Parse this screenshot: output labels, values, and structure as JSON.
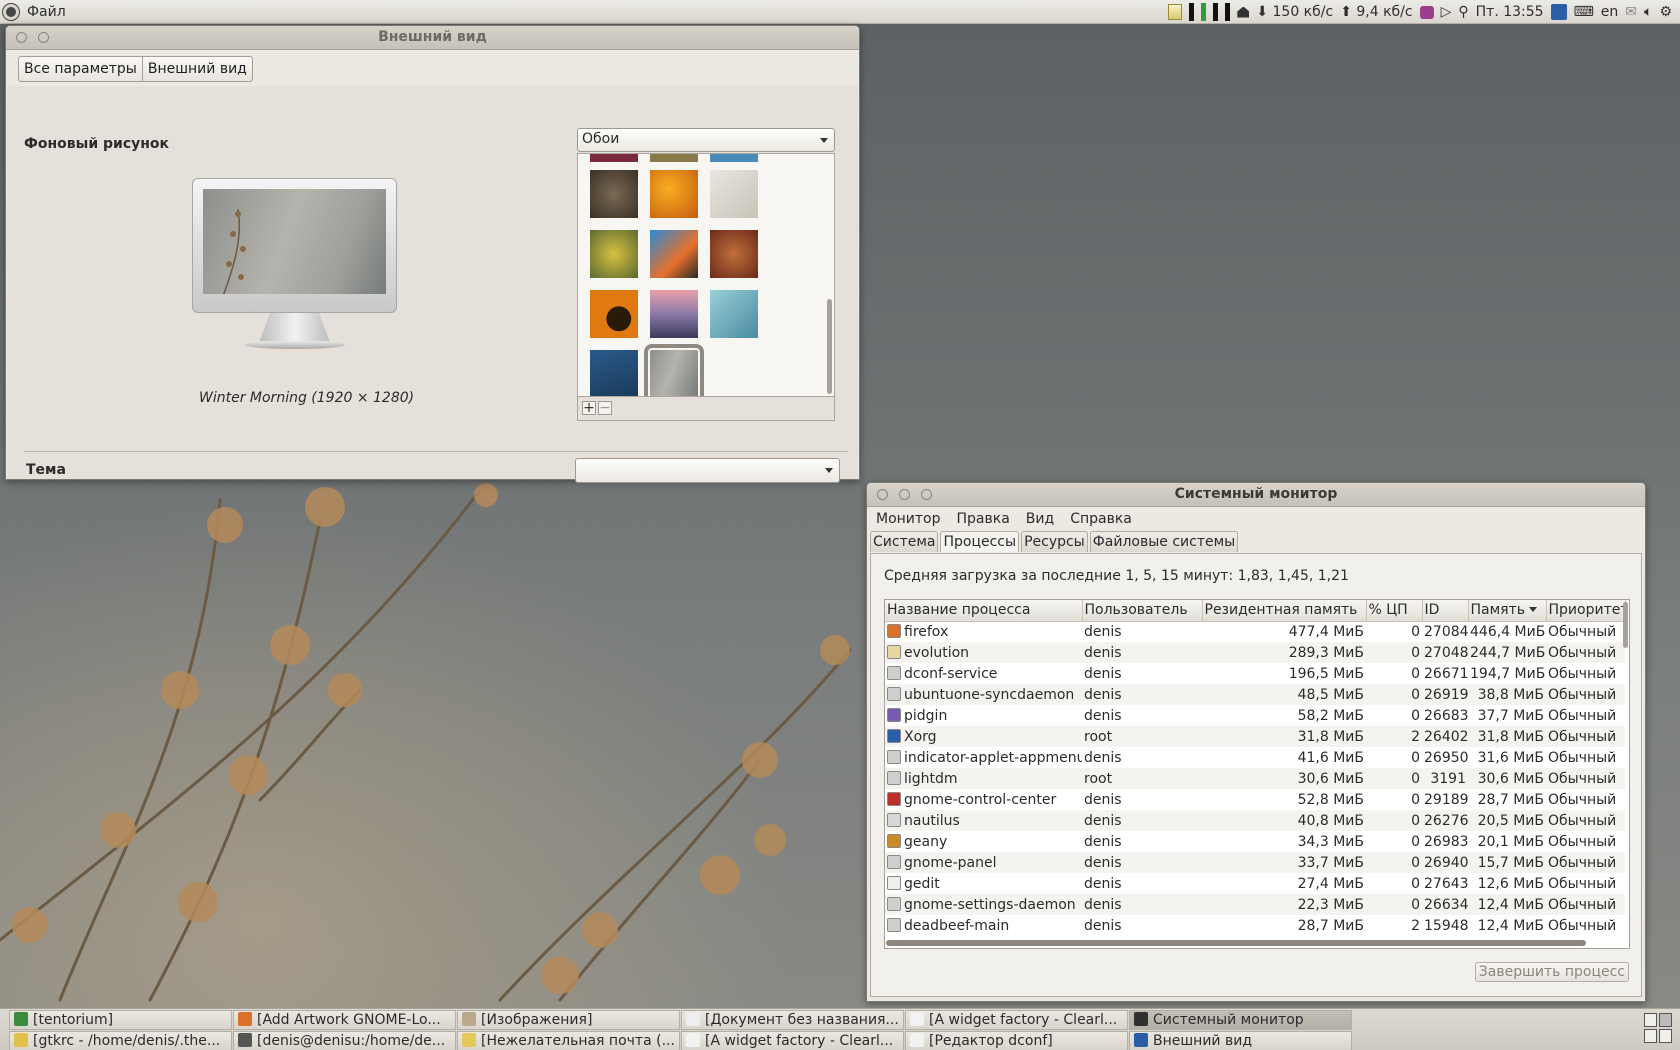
{
  "top_panel": {
    "app_menu": "Файл",
    "net_down": "150 кб/с",
    "net_up": "9,4 кб/с",
    "clock": "Пт. 13:55",
    "keyboard_layout": "en"
  },
  "appearance": {
    "title": "Внешний вид",
    "crumbs": [
      "Все параметры",
      "Внешний вид"
    ],
    "background_label": "Фоновый рисунок",
    "wallpaper_name": "Winter Morning (1920 × 1280)",
    "wallpaper_source": "Обои",
    "add_label": "+",
    "remove_label": "−",
    "theme_label": "Тема",
    "theme_value": ""
  },
  "sysmon": {
    "title": "Системный монитор",
    "menu": [
      "Монитор",
      "Правка",
      "Вид",
      "Справка"
    ],
    "tabs": [
      "Система",
      "Процессы",
      "Ресурсы",
      "Файловые системы"
    ],
    "active_tab": "Процессы",
    "load_avg": "Средняя загрузка за последние 1, 5, 15 минут: 1,83, 1,45, 1,21",
    "columns": [
      "Название процесса",
      "Пользователь",
      "Резидентная память",
      "% ЦП",
      "ID",
      "Память",
      "Приоритет"
    ],
    "processes": [
      {
        "name": "firefox",
        "user": "denis",
        "rss": "477,4 МиБ",
        "cpu": "0",
        "id": "27084",
        "mem": "446,4 МиБ",
        "prio": "Обычный",
        "icon": "firefox-icon",
        "color": "#d9712b"
      },
      {
        "name": "evolution",
        "user": "denis",
        "rss": "289,3 МиБ",
        "cpu": "0",
        "id": "27048",
        "mem": "244,7 МиБ",
        "prio": "Обычный",
        "icon": "evolution-icon",
        "color": "#e6d6a3"
      },
      {
        "name": "dconf-service",
        "user": "denis",
        "rss": "196,5 МиБ",
        "cpu": "0",
        "id": "26671",
        "mem": "194,7 МиБ",
        "prio": "Обычный",
        "icon": "gear-icon",
        "color": "#cfcfcf"
      },
      {
        "name": "ubuntuone-syncdaemon",
        "user": "denis",
        "rss": "48,5 МиБ",
        "cpu": "0",
        "id": "26919",
        "mem": "38,8 МиБ",
        "prio": "Обычный",
        "icon": "gear-icon",
        "color": "#cfcfcf"
      },
      {
        "name": "pidgin",
        "user": "denis",
        "rss": "58,2 МиБ",
        "cpu": "0",
        "id": "26683",
        "mem": "37,7 МиБ",
        "prio": "Обычный",
        "icon": "pidgin-icon",
        "color": "#7a5ab0"
      },
      {
        "name": "Xorg",
        "user": "root",
        "rss": "31,8 МиБ",
        "cpu": "2",
        "id": "26402",
        "mem": "31,8 МиБ",
        "prio": "Обычный",
        "icon": "monitor-icon",
        "color": "#2a5fa8"
      },
      {
        "name": "indicator-applet-appmenu",
        "user": "denis",
        "rss": "41,6 МиБ",
        "cpu": "0",
        "id": "26950",
        "mem": "31,6 МиБ",
        "prio": "Обычный",
        "icon": "gear-icon",
        "color": "#cfcfcf"
      },
      {
        "name": "lightdm",
        "user": "root",
        "rss": "30,6 МиБ",
        "cpu": "0",
        "id": "3191",
        "mem": "30,6 МиБ",
        "prio": "Обычный",
        "icon": "gear-icon",
        "color": "#cfcfcf"
      },
      {
        "name": "gnome-control-center",
        "user": "denis",
        "rss": "52,8 МиБ",
        "cpu": "0",
        "id": "29189",
        "mem": "28,7 МиБ",
        "prio": "Обычный",
        "icon": "control-center-icon",
        "color": "#c0302a"
      },
      {
        "name": "nautilus",
        "user": "denis",
        "rss": "40,8 МиБ",
        "cpu": "0",
        "id": "26276",
        "mem": "20,5 МиБ",
        "prio": "Обычный",
        "icon": "file-manager-icon",
        "color": "#d8d8d8"
      },
      {
        "name": "geany",
        "user": "denis",
        "rss": "34,3 МиБ",
        "cpu": "0",
        "id": "26983",
        "mem": "20,1 МиБ",
        "prio": "Обычный",
        "icon": "geany-icon",
        "color": "#c98a2a"
      },
      {
        "name": "gnome-panel",
        "user": "denis",
        "rss": "33,7 МиБ",
        "cpu": "0",
        "id": "26940",
        "mem": "15,7 МиБ",
        "prio": "Обычный",
        "icon": "gear-icon",
        "color": "#cfcfcf"
      },
      {
        "name": "gedit",
        "user": "denis",
        "rss": "27,4 МиБ",
        "cpu": "0",
        "id": "27643",
        "mem": "12,6 МиБ",
        "prio": "Обычный",
        "icon": "text-editor-icon",
        "color": "#eeeeee"
      },
      {
        "name": "gnome-settings-daemon",
        "user": "denis",
        "rss": "22,3 МиБ",
        "cpu": "0",
        "id": "26634",
        "mem": "12,4 МиБ",
        "prio": "Обычный",
        "icon": "gear-icon",
        "color": "#cfcfcf"
      },
      {
        "name": "deadbeef-main",
        "user": "denis",
        "rss": "28,7 МиБ",
        "cpu": "2",
        "id": "15948",
        "mem": "12,4 МиБ",
        "prio": "Обычный",
        "icon": "gear-icon",
        "color": "#cfcfcf"
      }
    ],
    "end_process_label": "Завершить процесс"
  },
  "taskbar": {
    "tasks": [
      {
        "label": "[tentorium]",
        "icon": "vim-icon",
        "color": "#3c8a3c",
        "active": false
      },
      {
        "label": "[Add  Artwork GNOME-Lo...",
        "icon": "firefox-icon",
        "color": "#d9712b",
        "active": false
      },
      {
        "label": "[Изображения]",
        "icon": "folder-icon",
        "color": "#b8a98a",
        "active": false
      },
      {
        "label": "[Документ без названия...",
        "icon": "text-editor-icon",
        "color": "#eeeeee",
        "active": false
      },
      {
        "label": "[A widget factory - Clearl...",
        "icon": "window-icon",
        "color": "#f2f2f2",
        "active": false
      },
      {
        "label": "Системный монитор",
        "icon": "system-monitor-icon",
        "color": "#303030",
        "active": true
      },
      {
        "label": "[gtkrc - /home/denis/.the...",
        "icon": "geany-icon",
        "color": "#e3c04a",
        "active": false
      },
      {
        "label": "[denis@denisu:/home/de...",
        "icon": "terminal-icon",
        "color": "#555555",
        "active": false
      },
      {
        "label": "[Нежелательная почта (...",
        "icon": "evolution-icon",
        "color": "#e6c85a",
        "active": false
      },
      {
        "label": "[A widget factory - Clearl...",
        "icon": "window-icon",
        "color": "#f2f2f2",
        "active": false
      },
      {
        "label": "[Редактор dconf]",
        "icon": "window-icon",
        "color": "#f2f2f2",
        "active": false
      },
      {
        "label": "Внешний вид",
        "icon": "appearance-icon",
        "color": "#2a5fa8",
        "active": false
      }
    ]
  }
}
